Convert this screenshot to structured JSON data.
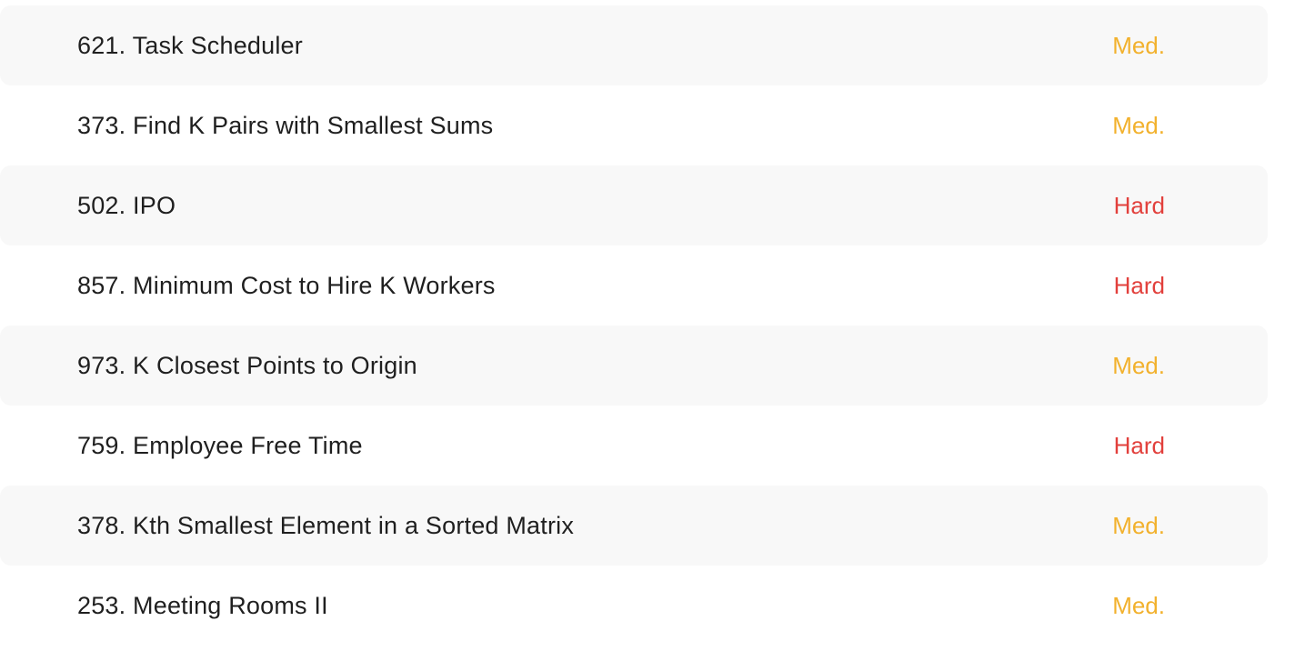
{
  "colors": {
    "medium": "#f2b12d",
    "hard": "#e2403c"
  },
  "problems": [
    {
      "title": "621. Task Scheduler",
      "difficulty": "Med.",
      "level": "medium"
    },
    {
      "title": "373. Find K Pairs with Smallest Sums",
      "difficulty": "Med.",
      "level": "medium"
    },
    {
      "title": "502. IPO",
      "difficulty": "Hard",
      "level": "hard"
    },
    {
      "title": "857. Minimum Cost to Hire K Workers",
      "difficulty": "Hard",
      "level": "hard"
    },
    {
      "title": "973. K Closest Points to Origin",
      "difficulty": "Med.",
      "level": "medium"
    },
    {
      "title": "759. Employee Free Time",
      "difficulty": "Hard",
      "level": "hard"
    },
    {
      "title": "378. Kth Smallest Element in a Sorted Matrix",
      "difficulty": "Med.",
      "level": "medium"
    },
    {
      "title": "253. Meeting Rooms II",
      "difficulty": "Med.",
      "level": "medium"
    }
  ]
}
